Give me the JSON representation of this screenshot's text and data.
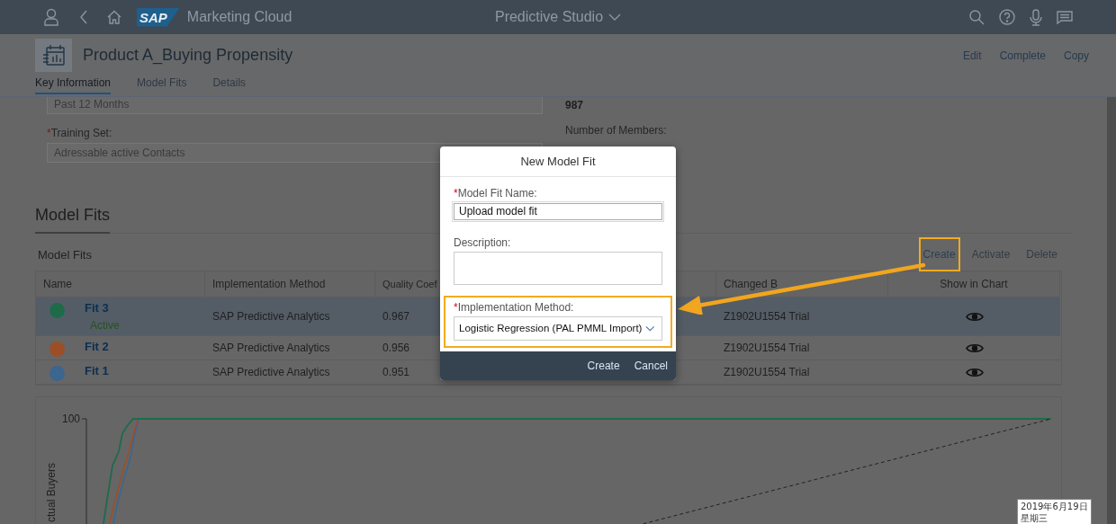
{
  "shell": {
    "logo": "SAP",
    "app_title": "Marketing Cloud",
    "center_title": "Predictive Studio"
  },
  "header": {
    "title": "Product A_Buying Propensity",
    "actions": [
      "Edit",
      "Complete",
      "Copy"
    ]
  },
  "tabs": [
    {
      "label": "Key Information",
      "selected": true
    },
    {
      "label": "Model Fits",
      "selected": false
    },
    {
      "label": "Details",
      "selected": false
    }
  ],
  "key_information": {
    "left_fields": [
      {
        "value": "Past 12 Months"
      },
      {
        "required_mark": "*",
        "label": "Training Set:",
        "value": "Adressable active Contacts"
      }
    ],
    "right_fields": [
      {
        "value": "987"
      },
      {
        "label": "Number of Members:"
      }
    ]
  },
  "section_title": "Model Fits",
  "table": {
    "title": "Model Fits",
    "actions": [
      {
        "label": "Create",
        "disabled": false,
        "highlighted": true
      },
      {
        "label": "Activate",
        "disabled": true,
        "highlighted": false
      },
      {
        "label": "Delete",
        "disabled": true,
        "highlighted": false
      }
    ],
    "columns": [
      "Name",
      "Implementation Method",
      "Quality Coef",
      "",
      "Changed B",
      "Show in Chart"
    ],
    "rows": [
      {
        "name": "Fit 3",
        "status": "Active",
        "color": "#1e6b4a",
        "selected": true,
        "method": "SAP Predictive Analytics",
        "quality": "0.967",
        "changed_by": "Z1902U1554 Trial"
      },
      {
        "name": "Fit 2",
        "color": "#9c4f26",
        "selected": false,
        "method": "SAP Predictive Analytics",
        "quality": "0.956",
        "changed_by": "Z1902U1554 Trial"
      },
      {
        "name": "Fit 1",
        "color": "#3c6590",
        "selected": false,
        "method": "SAP Predictive Analytics",
        "quality": "0.951",
        "changed_by": "Z1902U1554 Trial"
      }
    ]
  },
  "chart": {
    "y_tick": "100",
    "y_label": "ctual Buyers"
  },
  "dialog": {
    "title": "New Model Fit",
    "fields": [
      {
        "kind": "input",
        "required_mark": "*",
        "label": "Model Fit Name:",
        "value": "Upload model fit",
        "highlighted": false
      },
      {
        "kind": "textarea",
        "label": "Description:",
        "highlighted": false
      },
      {
        "kind": "select",
        "required_mark": "*",
        "label": "Implementation Method:",
        "value": "Logistic Regression (PAL PMML Import)",
        "highlighted": true
      }
    ],
    "buttons": [
      "Create",
      "Cancel"
    ]
  },
  "clock_tooltip": {
    "date": "2019年6月19日",
    "weekday": "星期三"
  }
}
